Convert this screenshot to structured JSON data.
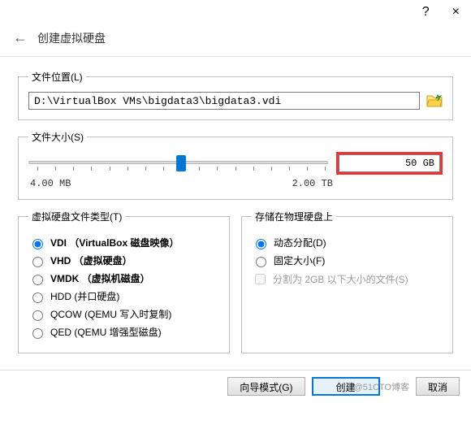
{
  "titlebar": {
    "help": "?",
    "close": "×"
  },
  "header": {
    "back": "←",
    "title": "创建虚拟硬盘"
  },
  "location": {
    "legend": "文件位置(L)",
    "path": "D:\\VirtualBox VMs\\bigdata3\\bigdata3.vdi"
  },
  "size": {
    "legend": "文件大小(S)",
    "value": "50 GB",
    "min_label": "4.00 MB",
    "max_label": "2.00 TB"
  },
  "filetype": {
    "legend": "虚拟硬盘文件类型(T)",
    "options": [
      "VDI （VirtualBox 磁盘映像）",
      "VHD （虚拟硬盘）",
      "VMDK （虚拟机磁盘）",
      "HDD (并口硬盘)",
      "QCOW (QEMU 写入时复制)",
      "QED (QEMU 增强型磁盘)"
    ]
  },
  "storage": {
    "legend": "存储在物理硬盘上",
    "dynamic": "动态分配(D)",
    "fixed": "固定大小(F)",
    "split": "分割为 2GB 以下大小的文件(S)"
  },
  "footer": {
    "wizard": "向导模式(G)",
    "create": "创建",
    "cancel": "取消",
    "watermark": "@51CTO博客"
  }
}
